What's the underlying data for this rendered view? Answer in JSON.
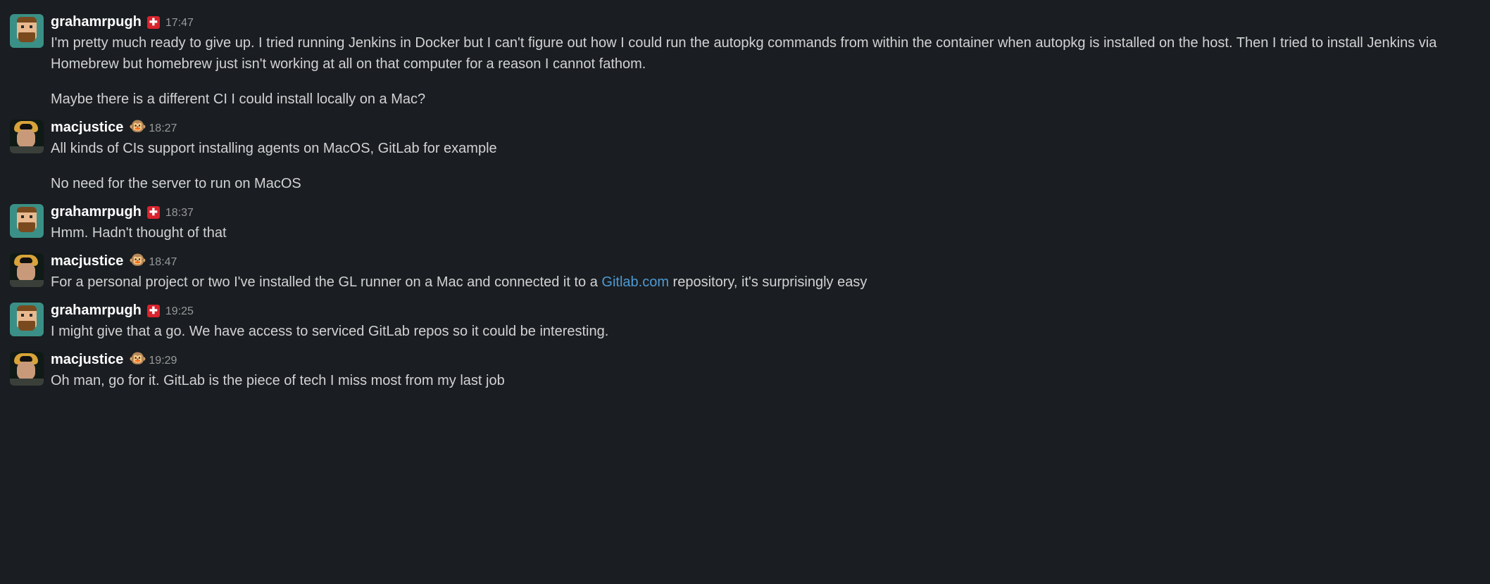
{
  "messages": [
    {
      "user": "grahamrpugh",
      "badge": "swiss",
      "time": "17:47",
      "paragraphs": [
        "I'm pretty much ready to give up. I tried running Jenkins in Docker but I can't figure out how I could run the autopkg commands from within the container when autopkg is installed on the host. Then I tried to install Jenkins via Homebrew but homebrew just isn't working at all on that computer for a reason I cannot fathom.",
        "Maybe there is a different CI I could install locally on a Mac?"
      ]
    },
    {
      "user": "macjustice",
      "badge": "emoji",
      "time": "18:27",
      "paragraphs": [
        "All kinds of CIs support installing agents on MacOS, GitLab for example",
        "No need for the server to run on MacOS"
      ]
    },
    {
      "user": "grahamrpugh",
      "badge": "swiss",
      "time": "18:37",
      "paragraphs": [
        "Hmm. Hadn't thought of that"
      ]
    },
    {
      "user": "macjustice",
      "badge": "emoji",
      "time": "18:47",
      "link": {
        "text": "Gitlab.com",
        "href": "#"
      },
      "paragraphs_parts": [
        {
          "before": "For a personal project or two I've installed the GL runner on a Mac and connected it to a ",
          "after": " repository, it's surprisingly easy"
        }
      ]
    },
    {
      "user": "grahamrpugh",
      "badge": "swiss",
      "time": "19:25",
      "paragraphs": [
        "I might give that a go. We have access to serviced GitLab repos so it could be interesting."
      ]
    },
    {
      "user": "macjustice",
      "badge": "emoji",
      "time": "19:29",
      "paragraphs": [
        "Oh man, go for it. GitLab is the piece of tech I miss most from my last job"
      ]
    }
  ],
  "badge_glyphs": {
    "swiss": "✚",
    "emoji": "🐵"
  }
}
